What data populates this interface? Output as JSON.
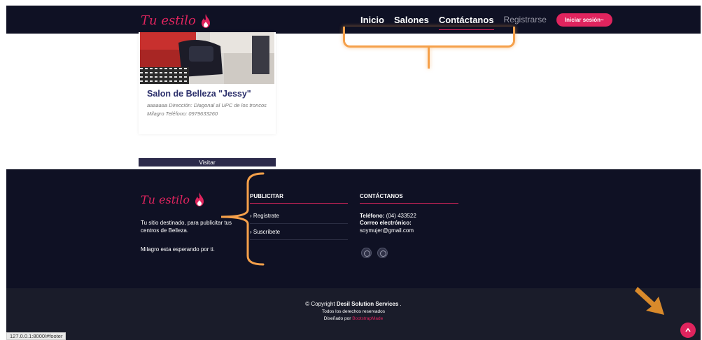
{
  "header": {
    "logo_text": "Tu estilo",
    "nav": [
      {
        "label": "Inicio"
      },
      {
        "label": "Salones"
      },
      {
        "label": "Contáctanos"
      },
      {
        "label": "Registrarse"
      }
    ],
    "login_label": "Iniciar sesión~"
  },
  "card": {
    "title": "Salon de Belleza \"Jessy\"",
    "description": "aaaaaaa Dirección: Diagonal al UPC de los troncos Milagro Teléfono: 0979633260",
    "button": "Visitar"
  },
  "footer": {
    "logo_text": "Tu estilo",
    "tagline": "Tu sitio destinado, para publicitar tus centros de Belleza.",
    "wait_text": "Milagro esta esperando por ti.",
    "publicitar": {
      "heading": "PUBLICITAR",
      "links": [
        "› Regístrate",
        "› Suscríbete"
      ]
    },
    "contact": {
      "heading": "CONTÁCTANOS",
      "phone_label": "Teléfono:",
      "phone": "(04) 433522",
      "email_label": "Correo electrónico:",
      "email": "soymujer@gmail.com"
    },
    "copyright_prefix": "© Copyright",
    "company": "Desil Solution Services",
    "copyright_suffix": ".",
    "rights": "Todos los derechos reservados",
    "designed_prefix": "Diseñado por",
    "designer": "BootstrapMade"
  },
  "status_url": "127.0.0.1:8000/#footer",
  "icons": {
    "flame": "flame-icon",
    "back_to_top": "chevron-up-icon",
    "social": "social-circle-icon"
  },
  "colors": {
    "accent": "#e0245e",
    "dark_navy": "#0f1124",
    "annotation": "#f5a04a"
  }
}
